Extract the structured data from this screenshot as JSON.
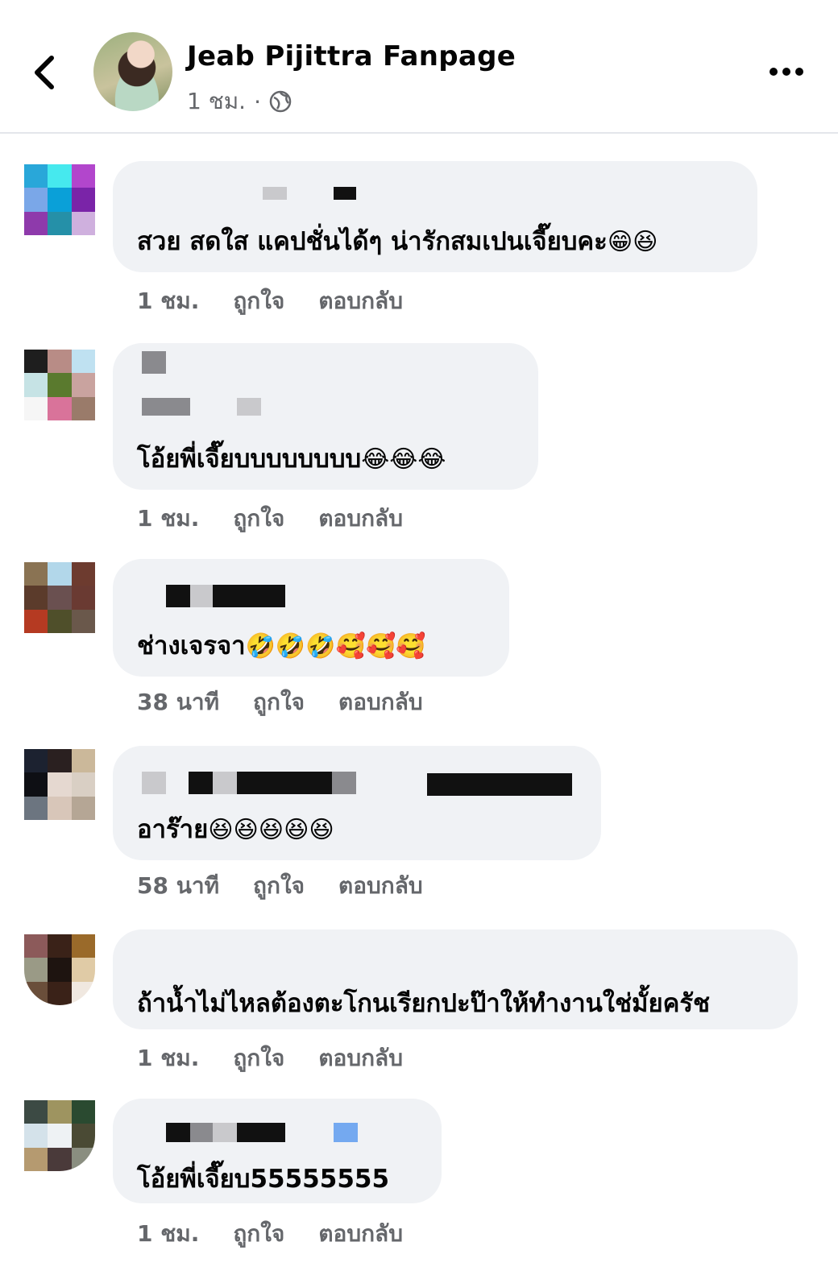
{
  "header": {
    "page_name": "Jeab Pijittra Fanpage",
    "time": "1 ชม.",
    "separator": "·",
    "back_icon": "chevron-left-icon",
    "privacy_icon": "globe-icon",
    "more_icon": "more-horizontal-icon"
  },
  "comments": [
    {
      "text": "สวย สดใส แคปชั่นได้ๆ น่ารักสมเปนเจี๊ยบคะ",
      "emojis": "😁😆",
      "time": "1 ชม.",
      "like": "ถูกใจ",
      "reply": "ตอบกลับ",
      "avatar_colors": [
        "#29a7d9",
        "#46e9ee",
        "#b246cc",
        "#7aa7e8",
        "#0aa0d8",
        "#7a24a8",
        "#8e3aab",
        "#2590a8",
        "#cfb0de"
      ]
    },
    {
      "text": "โอ้ยพี่เจี๊ยบบบบบบบบ",
      "emojis": "😂😂😂",
      "time": "1 ชม.",
      "like": "ถูกใจ",
      "reply": "ตอบกลับ",
      "avatar_colors": [
        "#1e1e1e",
        "#b88c86",
        "#bfe1f1",
        "#c6e3e5",
        "#5a7a2e",
        "#c9a39f",
        "#f6f6f6",
        "#d9739a",
        "#9a7b6a"
      ]
    },
    {
      "text": "ช่างเจรจา",
      "emojis": "🤣🤣🤣🥰🥰🥰",
      "time": "38 นาที",
      "like": "ถูกใจ",
      "reply": "ตอบกลับ",
      "avatar_colors": [
        "#8a7353",
        "#b2d7ea",
        "#6d3b2f",
        "#5b3b2b",
        "#6a5050",
        "#6a3a32",
        "#b53a22",
        "#4f4f2a",
        "#6a584b"
      ]
    },
    {
      "text": "อาร๊าย",
      "emojis": "😆😆😆😆😆",
      "time": "58 นาที",
      "like": "ถูกใจ",
      "reply": "ตอบกลับ",
      "avatar_colors": [
        "#1c2230",
        "#2a2020",
        "#cbb89a",
        "#0e0f14",
        "#e5d8d0",
        "#d9cfc4",
        "#6c7580",
        "#d8c6b9",
        "#b5a695"
      ]
    },
    {
      "text": "ถ้าน้ำไม่ไหลต้องตะโกนเรียกปะป๊าให้ทำงานใช่มั้ยครัช",
      "emojis": "",
      "time": "1 ชม.",
      "like": "ถูกใจ",
      "reply": "ตอบกลับ",
      "avatar_colors": [
        "#8c5a5a",
        "#3a2218",
        "#9a6a2a",
        "#9a9a86",
        "#1e1410",
        "#e0cba6",
        "#6a4e3a",
        "#3a2218",
        "#f0e8e0"
      ]
    },
    {
      "text": "โอ้ยพี่เจี๊ยบ55555555",
      "emojis": "",
      "time": "1 ชม.",
      "like": "ถูกใจ",
      "reply": "ตอบกลับ",
      "avatar_colors": [
        "#3c4a44",
        "#9e9460",
        "#2a4a30",
        "#d4e2ea",
        "#eef2f4",
        "#4a4a34",
        "#b59a70",
        "#4a3a3a",
        "#8a8e80"
      ]
    }
  ]
}
